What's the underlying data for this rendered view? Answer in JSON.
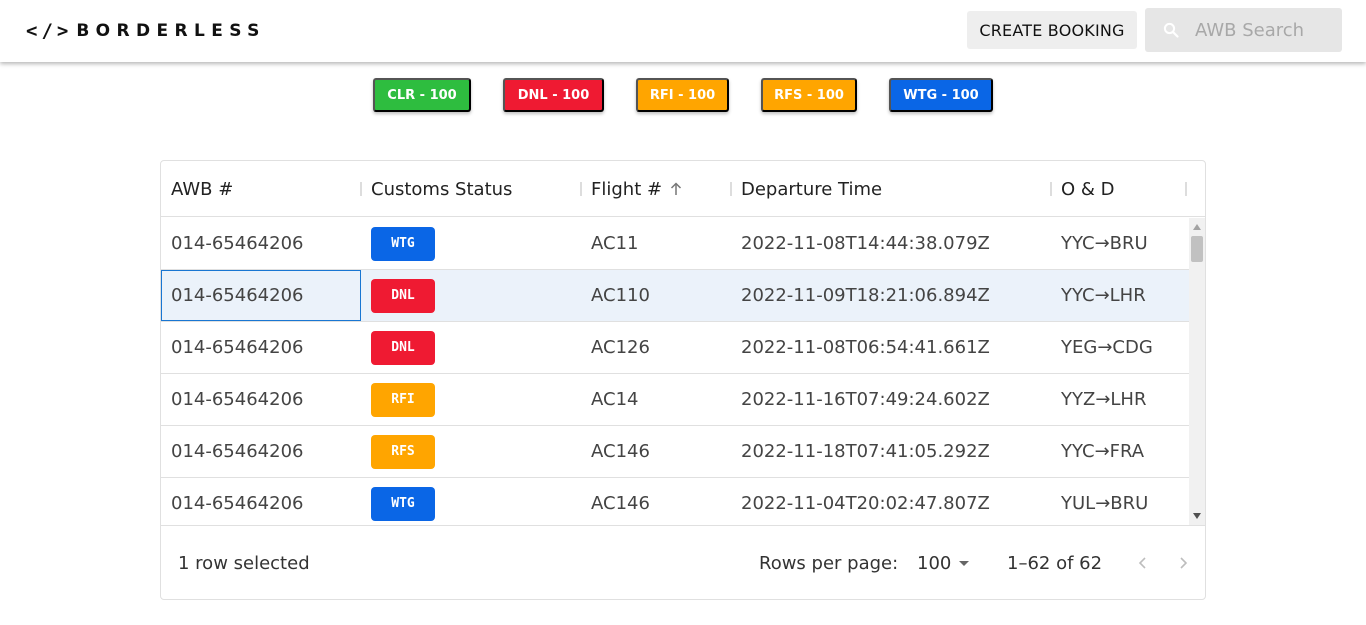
{
  "app": {
    "logo_brackets": "</>",
    "logo_text": "BORDERLESS",
    "create_booking_label": "CREATE BOOKING",
    "search_placeholder": "AWB Search",
    "search_value": ""
  },
  "filters": [
    {
      "label": "CLR - 100",
      "color": "#2ebd3f"
    },
    {
      "label": "DNL - 100",
      "color": "#ef1a32"
    },
    {
      "label": "RFI - 100",
      "color": "#ffa500"
    },
    {
      "label": "RFS - 100",
      "color": "#ffa500"
    },
    {
      "label": "WTG - 100",
      "color": "#0a66e6"
    }
  ],
  "grid": {
    "columns": [
      {
        "label": "AWB #",
        "sorted": false
      },
      {
        "label": "Customs Status",
        "sorted": false
      },
      {
        "label": "Flight #",
        "sorted": "asc"
      },
      {
        "label": "Departure Time",
        "sorted": false
      },
      {
        "label": "O & D",
        "sorted": false
      }
    ],
    "rows": [
      {
        "awb": "014-65464206",
        "status": "WTG",
        "status_color": "#0a66e6",
        "flight": "AC11",
        "departure": "2022-11-08T14:44:38.079Z",
        "od": "YYC→BRU",
        "selected": false
      },
      {
        "awb": "014-65464206",
        "status": "DNL",
        "status_color": "#ef1a32",
        "flight": "AC110",
        "departure": "2022-11-09T18:21:06.894Z",
        "od": "YYC→LHR",
        "selected": true
      },
      {
        "awb": "014-65464206",
        "status": "DNL",
        "status_color": "#ef1a32",
        "flight": "AC126",
        "departure": "2022-11-08T06:54:41.661Z",
        "od": "YEG→CDG",
        "selected": false
      },
      {
        "awb": "014-65464206",
        "status": "RFI",
        "status_color": "#ffa500",
        "flight": "AC14",
        "departure": "2022-11-16T07:49:24.602Z",
        "od": "YYZ→LHR",
        "selected": false
      },
      {
        "awb": "014-65464206",
        "status": "RFS",
        "status_color": "#ffa500",
        "flight": "AC146",
        "departure": "2022-11-18T07:41:05.292Z",
        "od": "YYC→FRA",
        "selected": false
      },
      {
        "awb": "014-65464206",
        "status": "WTG",
        "status_color": "#0a66e6",
        "flight": "AC146",
        "departure": "2022-11-04T20:02:47.807Z",
        "od": "YUL→BRU",
        "selected": false
      }
    ]
  },
  "footer": {
    "selection_text": "1 row selected",
    "rows_per_page_label": "Rows per page:",
    "rows_per_page_value": "100",
    "range_text": "1–62 of 62"
  }
}
